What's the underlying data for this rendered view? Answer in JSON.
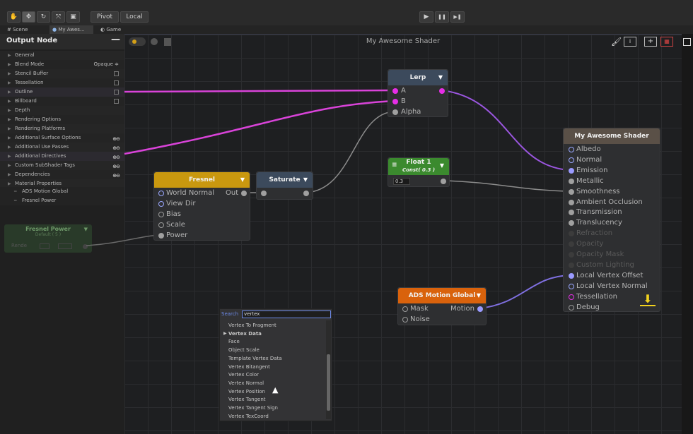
{
  "toolbar": {
    "pivot": "Pivot",
    "local": "Local",
    "play": "▶",
    "pause": "❚❚",
    "step": "▶❚"
  },
  "tabs": {
    "scene": "Scene",
    "shader": "My Awes...",
    "game": "Game"
  },
  "panel": {
    "title": "Output Node",
    "properties": [
      {
        "label": "General"
      },
      {
        "label": "Blend Mode",
        "value": "Opaque ≑"
      },
      {
        "label": "Stencil Buffer",
        "check": true
      },
      {
        "label": "Tessellation",
        "check": true
      },
      {
        "label": "Outline",
        "check": true
      },
      {
        "label": "Billboard",
        "check": true
      },
      {
        "label": "Depth"
      },
      {
        "label": "Rendering Options"
      },
      {
        "label": "Rendering Platforms"
      },
      {
        "label": "Additional Surface Options",
        "pm": true
      },
      {
        "label": "Additional Use Passes",
        "pm": true
      },
      {
        "label": "Additional Directives",
        "pm": true
      },
      {
        "label": "Custom SubShader Tags",
        "pm": true
      },
      {
        "label": "Dependencies",
        "pm": true
      },
      {
        "label": "Material Properties"
      }
    ],
    "sub_items": [
      "ADS Motion Global",
      "Fresnel Power"
    ]
  },
  "ghost_node": {
    "title": "Fresnel Power",
    "sub": "Default ( 5 )",
    "field_label": "Rende"
  },
  "canvas": {
    "title": "My Awesome Shader"
  },
  "nodes": {
    "lerp": {
      "title": "Lerp",
      "inputs": [
        "A",
        "B",
        "Alpha"
      ]
    },
    "fresnel": {
      "title": "Fresnel",
      "inputs": [
        "World Normal",
        "View Dir",
        "Bias",
        "Scale",
        "Power"
      ],
      "output": "Out"
    },
    "saturate": {
      "title": "Saturate"
    },
    "float1": {
      "title": "Float 1",
      "sub": "Const( 0.3 )",
      "value": "0.3"
    },
    "ads": {
      "title": "ADS Motion Global",
      "inputs": [
        "Mask",
        "Noise"
      ],
      "output": "Motion"
    },
    "master": {
      "title": "My Awesome Shader",
      "inputs": [
        "Albedo",
        "Normal",
        "Emission",
        "Metallic",
        "Smoothness",
        "Ambient Occlusion",
        "Transmission",
        "Translucency",
        "Refraction",
        "Opacity",
        "Opacity Mask",
        "Custom Lighting",
        "Local Vertex Offset",
        "Local Vertex Normal",
        "Tessellation",
        "Debug"
      ]
    }
  },
  "search": {
    "label": "Search",
    "value": "vertex",
    "results": [
      "Vertex To Fragment",
      "Vertex Data",
      "Face",
      "Object Scale",
      "Template Vertex Data",
      "Vertex Bitangent",
      "Vertex Color",
      "Vertex Normal",
      "Vertex Position",
      "Vertex Tangent",
      "Vertex Tangent Sign",
      "Vertex TexCoord"
    ]
  },
  "colors": {
    "fresnel": "#c9980f",
    "saturate": "#3c4a5c",
    "lerp": "#3c4a5c",
    "float": "#3b8a2e",
    "ads": "#d9620c",
    "master": "#5a5047",
    "wire_pink": "#d943d9",
    "wire_purple": "#9b56e0",
    "wire_gray": "#8c8c8c",
    "wire_blue": "#7f6fe0"
  }
}
